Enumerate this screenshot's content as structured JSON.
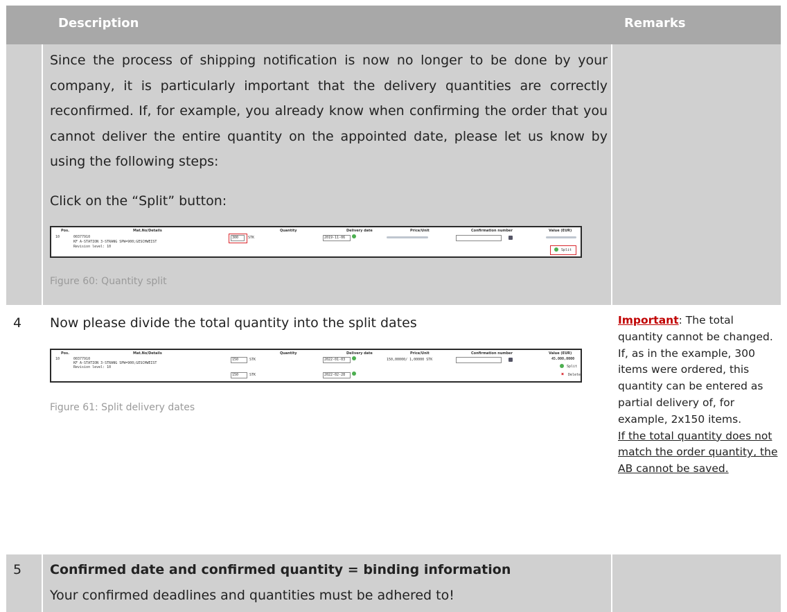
{
  "header": {
    "description": "Description",
    "remarks": "Remarks"
  },
  "row1": {
    "paragraph": "Since the process of shipping notification is now no longer to be done by your company, it is particularly important that the delivery quantities are correctly reconfirmed. If, for example, you already know when confirming the order that you cannot deliver the entire quantity on the appointed date, please let us know by using the following steps:",
    "click_line": "Click on the “Split” button:",
    "caption": "Figure 60: Quantity split",
    "figure": {
      "cols": [
        "Pos.",
        "Mat.No/Details",
        "Quantity",
        "Delivery date",
        "Price/Unit",
        "Confirmation number",
        "Value (EUR)"
      ],
      "pos": "10",
      "mat_no": "00377910",
      "mat_desc": "KF A-STATION 3-STRANG SPW=900;GESCHWEIST",
      "revision": "Revision level: 10",
      "qty": "300",
      "unit": "STK",
      "date": "2019-11-06",
      "split_label": "Split"
    }
  },
  "row2": {
    "num": "4",
    "heading": "Now please divide the total quantity into the split dates",
    "caption": "Figure 61: Split delivery dates",
    "figure": {
      "cols": [
        "Pos.",
        "Mat.No/Details",
        "Quantity",
        "Delivery date",
        "Price/Unit",
        "Confirmation number",
        "Value (EUR)"
      ],
      "pos": "10",
      "mat_no": "00377910",
      "mat_desc": "KF A-STATION 3-STRANG SPW=900;GESCHWEIST",
      "revision": "Revision level: 10",
      "qty1": "150",
      "qty2": "150",
      "unit": "STK",
      "date1": "2022-01-03",
      "date2": "2022-02-28",
      "price": "150,00000/ 1,00000 STK",
      "value": "45.000,0000",
      "split_label": "Split",
      "delete_label": "Delete"
    },
    "remarks": {
      "important": "Important",
      "text1": ": The total quantity cannot be changed. If, as in the example, 300 items were ordered, this quantity can be entered as partial delivery of, for example, 2x150 items.",
      "text2": "If the total quantity does not match the order quantity, the AB cannot be saved."
    }
  },
  "row3": {
    "num": "5",
    "bold": "Confirmed date and confirmed quantity = binding information",
    "text": "Your confirmed deadlines and quantities must be adhered to!"
  }
}
